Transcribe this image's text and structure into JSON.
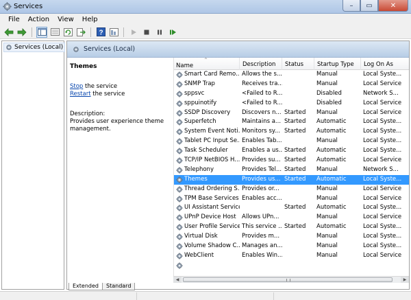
{
  "window": {
    "title": "Services",
    "minimize_glyph": "–",
    "maximize_glyph": "▭",
    "close_glyph": "✕"
  },
  "menu": [
    "File",
    "Action",
    "View",
    "Help"
  ],
  "toolbar_icons": [
    "back-arrow-icon",
    "forward-arrow-icon",
    "show-tree-icon",
    "export-list-icon",
    "refresh-icon",
    "export-icon",
    "help-icon",
    "properties-icon",
    "play-icon",
    "stop-icon",
    "pause-icon",
    "restart-icon"
  ],
  "tree": {
    "root": "Services (Local)"
  },
  "panel": {
    "header": "Services (Local)"
  },
  "detail": {
    "title": "Themes",
    "stop_link": "Stop",
    "stop_rest": " the service",
    "restart_link": "Restart",
    "restart_rest": " the service",
    "desc_label": "Description:",
    "desc_text": "Provides user experience theme management."
  },
  "columns": {
    "name": "Name",
    "description": "Description",
    "status": "Status",
    "startup": "Startup Type",
    "logon": "Log On As",
    "sort_arrow": "^"
  },
  "services": [
    {
      "name": "Smart Card Remo...",
      "description": "Allows the s...",
      "status": "",
      "startup": "Manual",
      "logon": "Local Syste..."
    },
    {
      "name": "SNMP Trap",
      "description": "Receives tra...",
      "status": "",
      "startup": "Manual",
      "logon": "Local Service"
    },
    {
      "name": "sppsvc",
      "description": "<Failed to R...",
      "status": "",
      "startup": "Disabled",
      "logon": "Network S..."
    },
    {
      "name": "sppuinotify",
      "description": "<Failed to R...",
      "status": "",
      "startup": "Disabled",
      "logon": "Local Service"
    },
    {
      "name": "SSDP Discovery",
      "description": "Discovers n...",
      "status": "Started",
      "startup": "Manual",
      "logon": "Local Service"
    },
    {
      "name": "Superfetch",
      "description": "Maintains a...",
      "status": "Started",
      "startup": "Automatic",
      "logon": "Local Syste..."
    },
    {
      "name": "System Event Noti...",
      "description": "Monitors sy...",
      "status": "Started",
      "startup": "Automatic",
      "logon": "Local Syste..."
    },
    {
      "name": "Tablet PC Input Se...",
      "description": "Enables Tab...",
      "status": "",
      "startup": "Manual",
      "logon": "Local Syste..."
    },
    {
      "name": "Task Scheduler",
      "description": "Enables a us...",
      "status": "Started",
      "startup": "Automatic",
      "logon": "Local Syste..."
    },
    {
      "name": "TCP/IP NetBIOS H...",
      "description": "Provides su...",
      "status": "Started",
      "startup": "Automatic",
      "logon": "Local Service"
    },
    {
      "name": "Telephony",
      "description": "Provides Tel...",
      "status": "Started",
      "startup": "Manual",
      "logon": "Network S..."
    },
    {
      "name": "Themes",
      "description": "Provides us...",
      "status": "Started",
      "startup": "Automatic",
      "logon": "Local Syste...",
      "selected": true
    },
    {
      "name": "Thread Ordering S...",
      "description": "Provides or...",
      "status": "",
      "startup": "Manual",
      "logon": "Local Service"
    },
    {
      "name": "TPM Base Services",
      "description": "Enables acc...",
      "status": "",
      "startup": "Manual",
      "logon": "Local Service"
    },
    {
      "name": "UI Assistant Service",
      "description": "",
      "status": "Started",
      "startup": "Automatic",
      "logon": "Local Syste..."
    },
    {
      "name": "UPnP Device Host",
      "description": "Allows UPn...",
      "status": "",
      "startup": "Manual",
      "logon": "Local Service"
    },
    {
      "name": "User Profile Service",
      "description": "This service ...",
      "status": "Started",
      "startup": "Automatic",
      "logon": "Local Syste..."
    },
    {
      "name": "Virtual Disk",
      "description": "Provides m...",
      "status": "",
      "startup": "Manual",
      "logon": "Local Syste..."
    },
    {
      "name": "Volume Shadow C...",
      "description": "Manages an...",
      "status": "",
      "startup": "Manual",
      "logon": "Local Syste..."
    },
    {
      "name": "WebClient",
      "description": "Enables Win...",
      "status": "",
      "startup": "Manual",
      "logon": "Local Service"
    },
    {
      "name": "",
      "description": "",
      "status": "",
      "startup": "",
      "logon": ""
    }
  ],
  "tabs": [
    "Extended",
    "Standard"
  ],
  "colors": {
    "selection": "#3399ff",
    "link": "#0645ad",
    "header_gradient_top": "#dde8f4",
    "header_gradient_bottom": "#b7cde6"
  }
}
